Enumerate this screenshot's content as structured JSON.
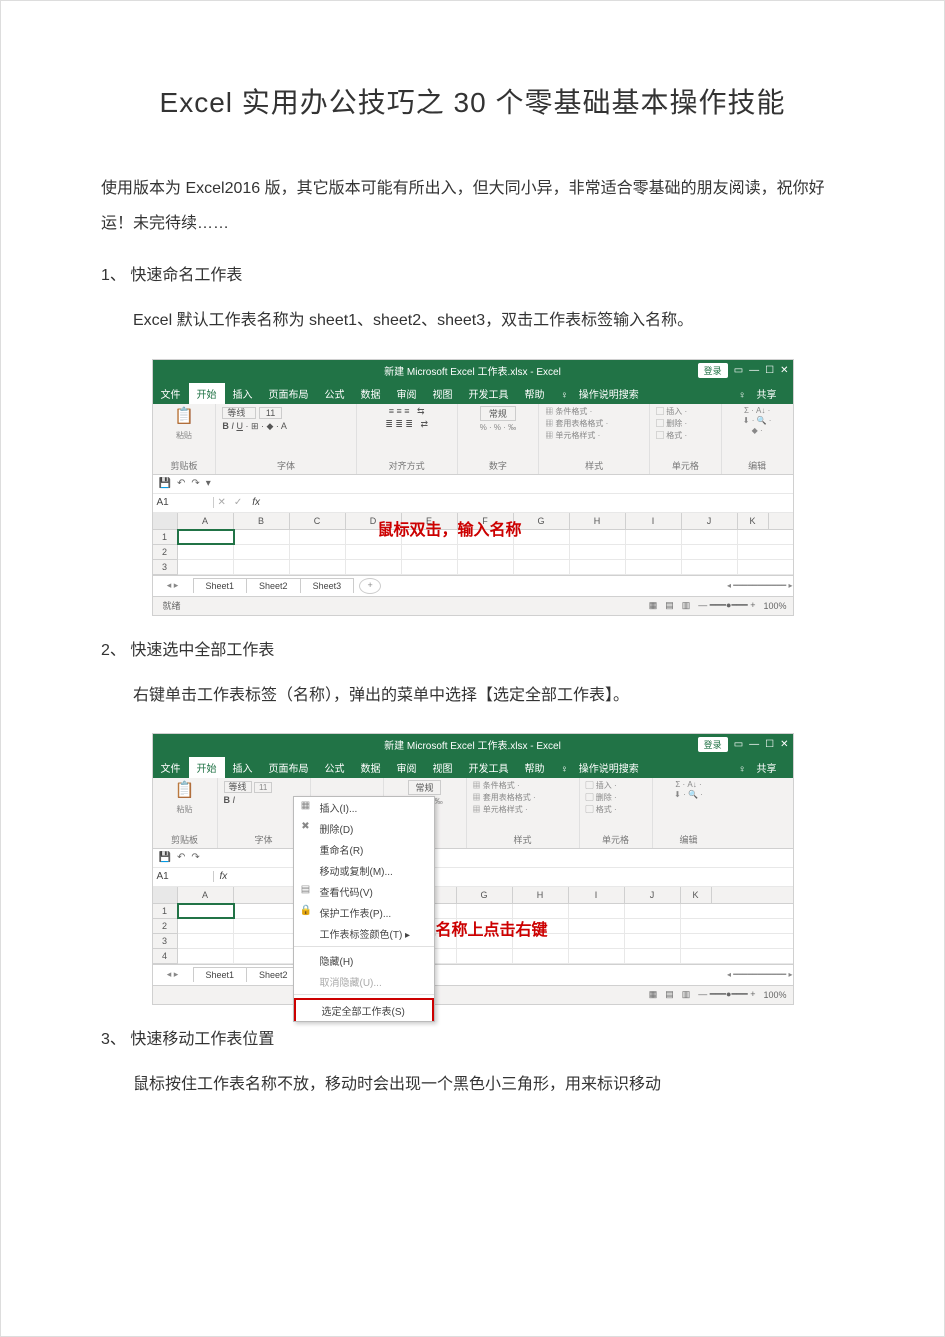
{
  "title": "Excel 实用办公技巧之 30 个零基础基本操作技能",
  "intro": "使用版本为 Excel2016 版，其它版本可能有所出入，但大同小异，非常适合零基础的朋友阅读，祝你好运！未完待续……",
  "tips": [
    {
      "num": "1、",
      "title": "快速命名工作表",
      "desc": "Excel 默认工作表名称为 sheet1、sheet2、sheet3，双击工作表标签输入名称。"
    },
    {
      "num": "2、",
      "title": "快速选中全部工作表",
      "desc": "右键单击工作表标签（名称），弹出的菜单中选择【选定全部工作表】。"
    },
    {
      "num": "3、",
      "title": "快速移动工作表位置",
      "desc": "鼠标按住工作表名称不放，移动时会出现一个黑色小三角形，用来标识移动"
    }
  ],
  "excel": {
    "title_text": "新建 Microsoft Excel 工作表.xlsx - Excel",
    "login": "登录",
    "tabs": {
      "file": "文件",
      "home": "开始",
      "insert": "插入",
      "layout": "页面布局",
      "formula": "公式",
      "data": "数据",
      "review": "审阅",
      "view": "视图",
      "dev": "开发工具",
      "help": "帮助",
      "tell": "操作说明搜索",
      "share": "共享"
    },
    "groups": {
      "clipboard": "剪贴板",
      "font": "字体",
      "align": "对齐方式",
      "number": "数字",
      "styles": "样式",
      "cells": "单元格",
      "editing": "编辑",
      "font_name": "等线",
      "font_size": "11",
      "number_fmt": "常规",
      "cond_fmt": "条件格式",
      "table_fmt": "套用表格格式",
      "cell_style": "单元格样式",
      "insert_btn": "插入",
      "delete_btn": "删除",
      "format_btn": "格式",
      "paste": "粘贴"
    },
    "namebox": "A1",
    "cols": [
      "A",
      "B",
      "C",
      "D",
      "E",
      "F",
      "G",
      "H",
      "I",
      "J",
      "K"
    ],
    "rows3": [
      "1",
      "2",
      "3"
    ],
    "rows4": [
      "1",
      "2",
      "3",
      "4"
    ],
    "sheets": [
      "Sheet1",
      "Sheet2",
      "Sheet3"
    ],
    "status": {
      "ready": "就绪",
      "zoom": "100%"
    }
  },
  "overlay1": "鼠标双击，输入名称",
  "overlay2": "工作表名称上点击右键",
  "ctx": {
    "insert": "插入(I)...",
    "delete": "删除(D)",
    "rename": "重命名(R)",
    "move": "移动或复制(M)...",
    "viewcode": "查看代码(V)",
    "protect": "保护工作表(P)...",
    "tabcolor": "工作表标签颜色(T)",
    "hide": "隐藏(H)",
    "unhide": "取消隐藏(U)...",
    "selectall": "选定全部工作表(S)"
  }
}
